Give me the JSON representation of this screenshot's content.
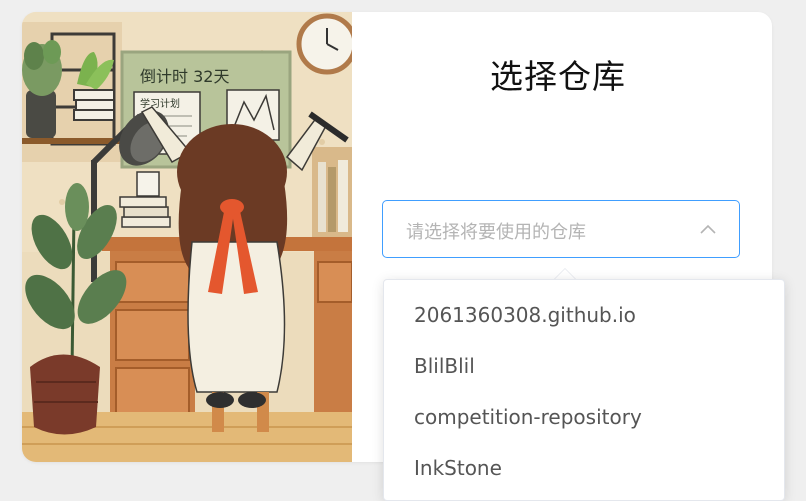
{
  "page": {
    "title": "选择仓库"
  },
  "select": {
    "placeholder": "请选择将要使用的仓库",
    "arrow_icon": "chevron-up-icon"
  },
  "options": [
    "2061360308.github.io",
    "BlilBlil",
    "competition-repository",
    "InkStone"
  ],
  "illustration": {
    "sign_text": "倒计时 32天",
    "paper_text": "学习计划"
  },
  "colors": {
    "accent": "#409eff",
    "placeholder": "#b4b4b4",
    "option_text": "#555555",
    "title_text": "#111111"
  }
}
